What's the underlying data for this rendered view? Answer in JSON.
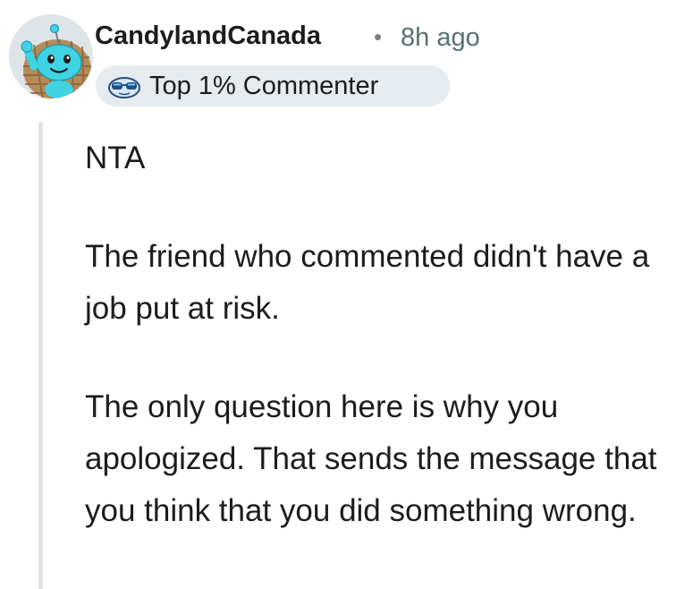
{
  "comment": {
    "author": {
      "username": "CandylandCanada",
      "avatar_icon": "snoo-avatar-icon",
      "flair": {
        "label": "Top 1% Commenter",
        "icon": "snoo-sunglasses-icon"
      }
    },
    "separator": "•",
    "timestamp": "8h ago",
    "paragraphs": [
      "NTA",
      "The friend who commented didn't have a job put at risk.",
      "The only question here is why you apologized. That sends the message that you think that you did something wrong."
    ]
  },
  "colors": {
    "text": "#1c1c1c",
    "meta": "#576f76",
    "flair_bg": "#e5ebee",
    "thread_line": "#e0e3e5",
    "avatar_cyan": "#3fd3e3"
  }
}
